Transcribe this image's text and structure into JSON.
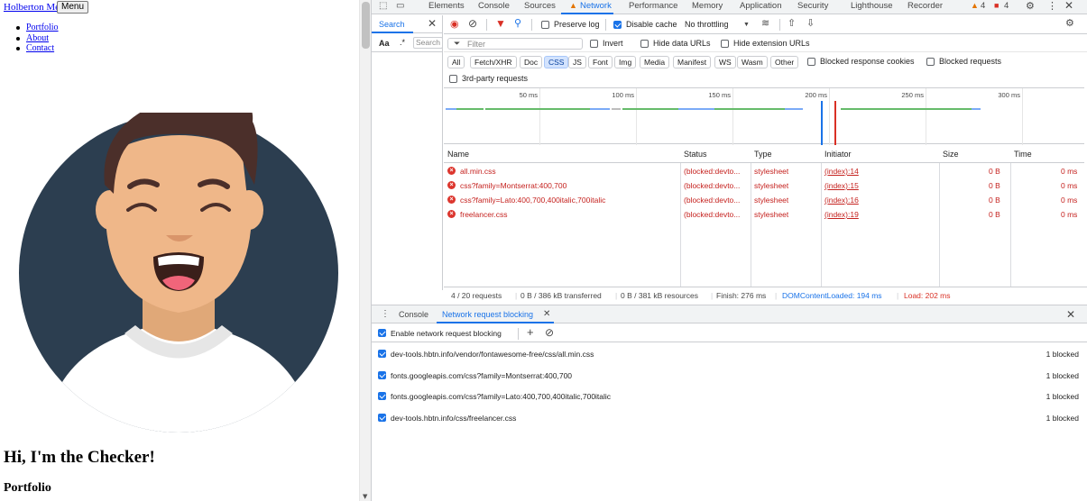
{
  "page": {
    "brand": "Holberton Me",
    "menu_button": "Menu",
    "nav": [
      "Portfolio",
      "About",
      "Contact"
    ],
    "hero_title": "Hi, I'm the Checker!",
    "section_title": "Portfolio"
  },
  "devtools": {
    "tabs": [
      "Elements",
      "Console",
      "Sources",
      "Network",
      "Performance",
      "Memory",
      "Application",
      "Security",
      "Lighthouse",
      "Recorder"
    ],
    "active_tab": "Network",
    "warnings_count": "4",
    "errors_count": "4",
    "search": {
      "tab_label": "Search",
      "case_toggle": "Aa",
      "regex_toggle": ".*",
      "placeholder": "Search"
    },
    "toolbar": {
      "preserve_log": "Preserve log",
      "disable_cache": "Disable cache",
      "throttling": "No throttling"
    },
    "filter_bar": {
      "placeholder": "Filter",
      "invert": "Invert",
      "hide_data_urls": "Hide data URLs",
      "hide_extension_urls": "Hide extension URLs"
    },
    "type_filters": [
      "All",
      "Fetch/XHR",
      "Doc",
      "CSS",
      "JS",
      "Font",
      "Img",
      "Media",
      "Manifest",
      "WS",
      "Wasm",
      "Other"
    ],
    "active_filter": "CSS",
    "blocked_response_cookies": "Blocked response cookies",
    "blocked_requests": "Blocked requests",
    "third_party": "3rd-party requests",
    "timeline_ticks": [
      "50 ms",
      "100 ms",
      "150 ms",
      "200 ms",
      "250 ms",
      "300 ms"
    ],
    "columns": [
      "Name",
      "Status",
      "Type",
      "Initiator",
      "Size",
      "Time"
    ],
    "requests": [
      {
        "name": "all.min.css",
        "status": "(blocked:devto...",
        "type": "stylesheet",
        "initiator": "(index):14",
        "size": "0 B",
        "time": "0 ms"
      },
      {
        "name": "css?family=Montserrat:400,700",
        "status": "(blocked:devto...",
        "type": "stylesheet",
        "initiator": "(index):15",
        "size": "0 B",
        "time": "0 ms"
      },
      {
        "name": "css?family=Lato:400,700,400italic,700italic",
        "status": "(blocked:devto...",
        "type": "stylesheet",
        "initiator": "(index):16",
        "size": "0 B",
        "time": "0 ms"
      },
      {
        "name": "freelancer.css",
        "status": "(blocked:devto...",
        "type": "stylesheet",
        "initiator": "(index):19",
        "size": "0 B",
        "time": "0 ms"
      }
    ],
    "status_bar": {
      "requests": "4 / 20 requests",
      "transferred": "0 B / 386 kB transferred",
      "resources": "0 B / 381 kB resources",
      "finish": "Finish: 276 ms",
      "dom_content_loaded": "DOMContentLoaded: 194 ms",
      "load": "Load: 202 ms"
    },
    "drawer": {
      "tabs": [
        "Console",
        "Network request blocking"
      ],
      "active": "Network request blocking",
      "enable_label": "Enable network request blocking",
      "patterns": [
        {
          "url": "dev-tools.hbtn.info/vendor/fontawesome-free/css/all.min.css",
          "count": "1 blocked"
        },
        {
          "url": "fonts.googleapis.com/css?family=Montserrat:400,700",
          "count": "1 blocked"
        },
        {
          "url": "fonts.googleapis.com/css?family=Lato:400,700,400italic,700italic",
          "count": "1 blocked"
        },
        {
          "url": "dev-tools.hbtn.info/css/freelancer.css",
          "count": "1 blocked"
        }
      ]
    }
  },
  "colors": {
    "accent": "#1a73e8",
    "error": "#c5221f",
    "dcl": "#1a73e8",
    "load": "#d93025",
    "avatar_bg": "#2c3e50",
    "skin": "#efb789",
    "hair": "#4b2f2a"
  }
}
